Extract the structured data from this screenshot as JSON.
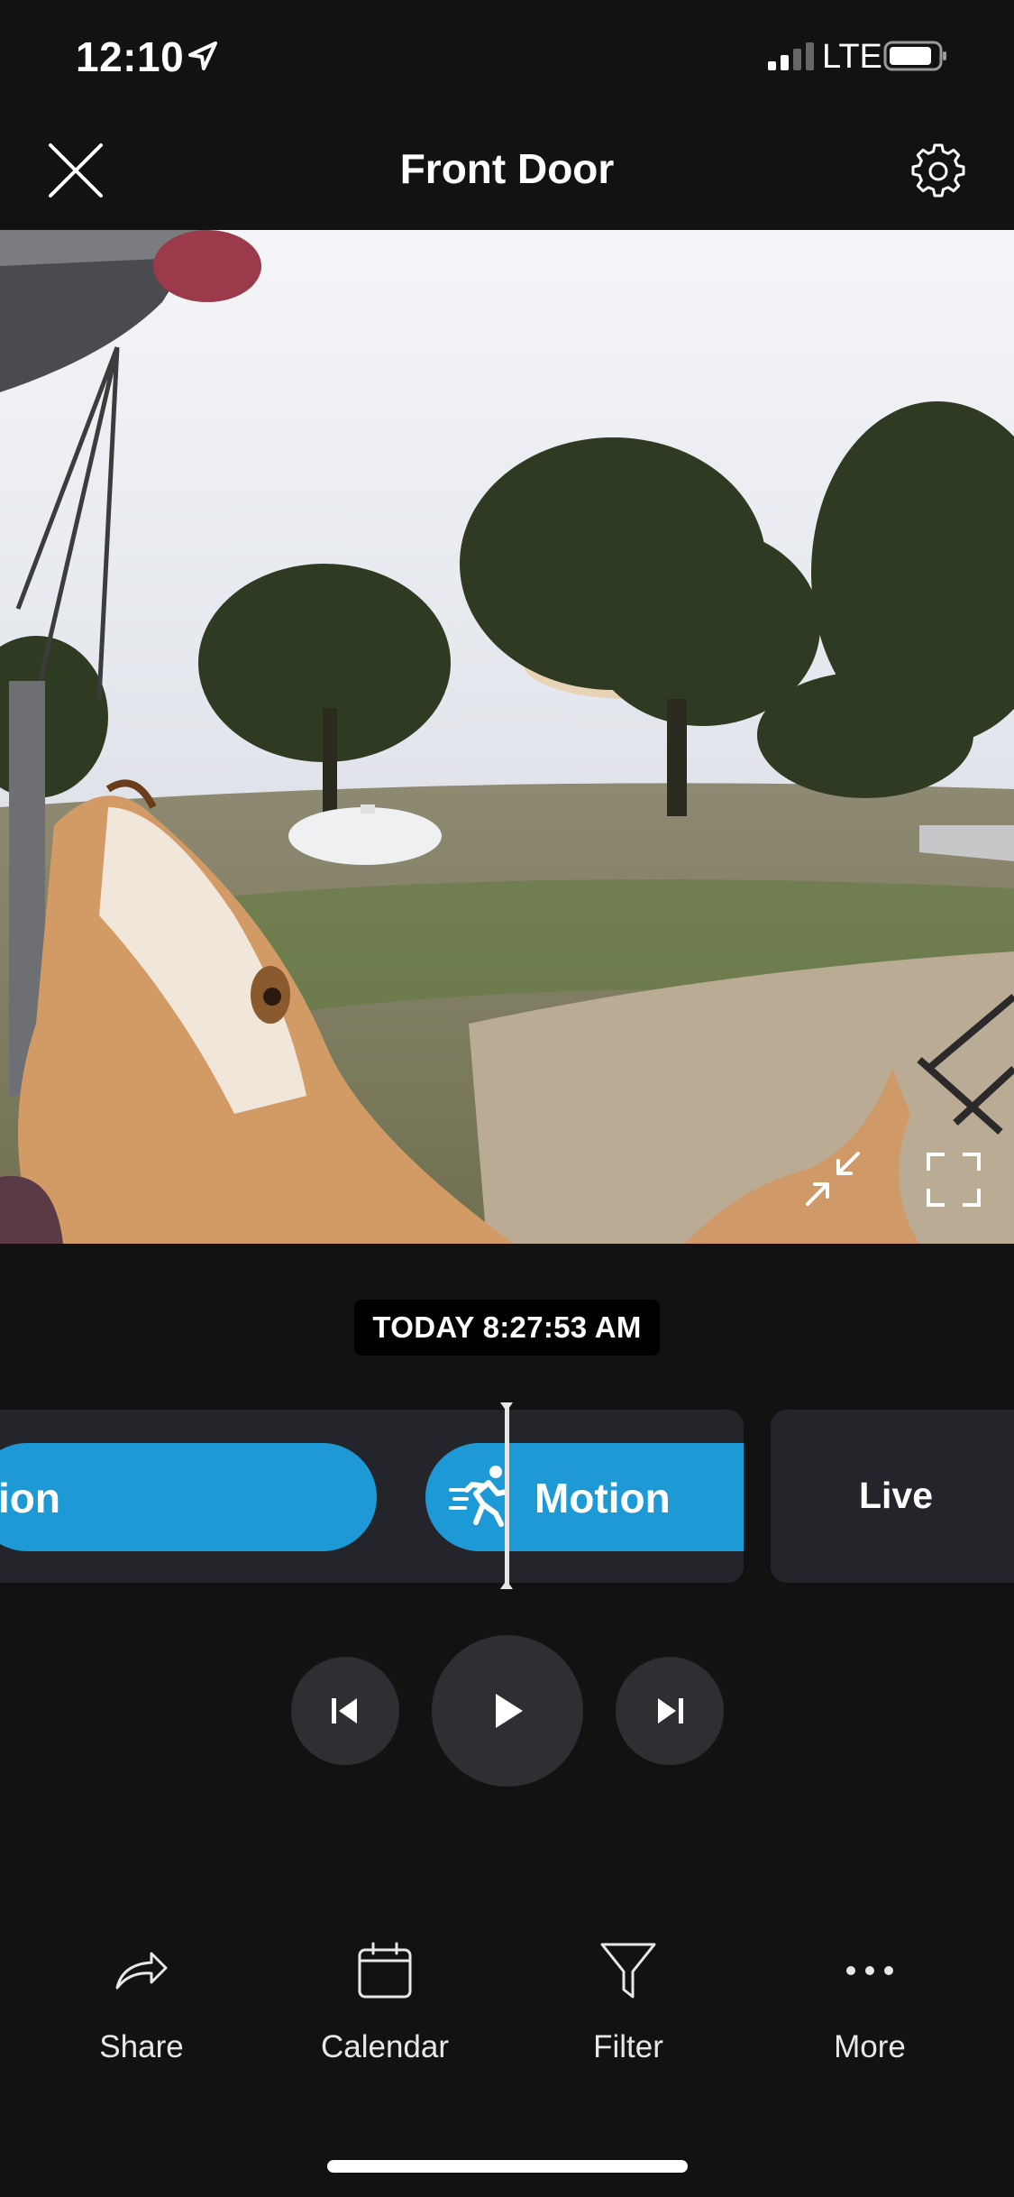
{
  "status_bar": {
    "time": "12:10",
    "network": "LTE"
  },
  "header": {
    "title": "Front Door"
  },
  "video": {
    "timestamp": "TODAY 8:27:53 AM"
  },
  "timeline": {
    "events": [
      {
        "label": "ion",
        "type": "motion"
      },
      {
        "label": "Motion",
        "type": "motion"
      }
    ],
    "live_label": "Live",
    "accent": "#1d9ad6"
  },
  "bottom_bar": {
    "share_label": "Share",
    "calendar_label": "Calendar",
    "filter_label": "Filter",
    "more_label": "More"
  },
  "icons": [
    "location-arrow-icon",
    "signal-icon",
    "battery-icon",
    "close-icon",
    "gear-icon",
    "exit-fullscreen-icon",
    "fullscreen-icon",
    "motion-runner-icon",
    "skip-previous-icon",
    "play-icon",
    "skip-next-icon",
    "share-arrow-icon",
    "calendar-icon",
    "filter-funnel-icon",
    "more-dots-icon"
  ]
}
